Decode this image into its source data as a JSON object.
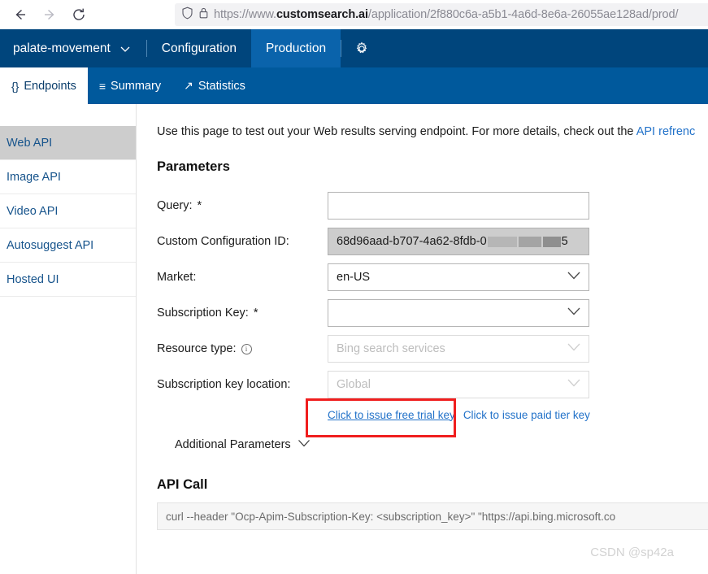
{
  "browser": {
    "back_icon": "arrow-left-icon",
    "forward_icon": "arrow-right-icon",
    "reload_icon": "reload-icon",
    "shield_icon": "shield-icon",
    "lock_icon": "lock-icon",
    "url_scheme": "https://www.",
    "url_host": "customsearch.ai",
    "url_path": "/application/2f880c6a-a5b1-4a6d-8e6a-26055ae128ad/prod/"
  },
  "header": {
    "app_name": "palate-movement",
    "app_chevron": "chevron-down-icon",
    "tabs": [
      {
        "label": "Configuration",
        "active": false
      },
      {
        "label": "Production",
        "active": true
      }
    ],
    "gear_icon": "gear-icon"
  },
  "subtabs": [
    {
      "label": "Endpoints",
      "glyph": "{}",
      "icon": "braces-icon",
      "active": true
    },
    {
      "label": "Summary",
      "glyph": "≡",
      "icon": "list-icon",
      "active": false
    },
    {
      "label": "Statistics",
      "glyph": "↗",
      "icon": "chart-line-icon",
      "active": false
    }
  ],
  "sidebar": {
    "items": [
      {
        "label": "Web API",
        "active": true
      },
      {
        "label": "Image API",
        "active": false
      },
      {
        "label": "Video API",
        "active": false
      },
      {
        "label": "Autosuggest API",
        "active": false
      },
      {
        "label": "Hosted UI",
        "active": false
      }
    ]
  },
  "main": {
    "intro_text": "Use this page to test out your Web results serving endpoint. For more details, check out the ",
    "intro_link": "API refrenc",
    "parameters_title": "Parameters",
    "fields": [
      {
        "label": "Query:",
        "required": "*",
        "value": "",
        "placeholder": "",
        "type": "text",
        "state": "enabled"
      },
      {
        "label": "Custom Configuration ID:",
        "required": "",
        "value": "68d96aad-b707-4a62-8fdb-0",
        "value_suffix": "5",
        "type": "text",
        "state": "readonly"
      },
      {
        "label": "Market:",
        "required": "",
        "value": "en-US",
        "type": "select",
        "state": "enabled"
      },
      {
        "label": "Subscription Key:",
        "required": "*",
        "value": "",
        "type": "select",
        "state": "enabled"
      },
      {
        "label": "Resource type:",
        "required": "",
        "info_icon": "info-icon",
        "value": "Bing search services",
        "type": "select",
        "state": "disabled"
      },
      {
        "label": "Subscription key location:",
        "required": "",
        "value": "Global",
        "type": "select",
        "state": "disabled"
      }
    ],
    "free_trial_link": "Click to issue free trial key",
    "paid_tier_link": "Click to issue paid tier key",
    "additional_parameters": "Additional Parameters",
    "additional_chevron": "chevron-down-icon",
    "api_call_title": "API Call",
    "api_call_code": "curl --header \"Ocp-Apim-Subscription-Key: <subscription_key>\" \"https://api.bing.microsoft.co"
  },
  "watermark": "CSDN @sp42a",
  "colors": {
    "header_blue": "#00457c",
    "active_tab_blue": "#0a63ab",
    "subtab_blue": "#00599c",
    "link_blue": "#2272c9",
    "sidebar_link": "#17548c",
    "annotation_red": "#f01e1e"
  }
}
